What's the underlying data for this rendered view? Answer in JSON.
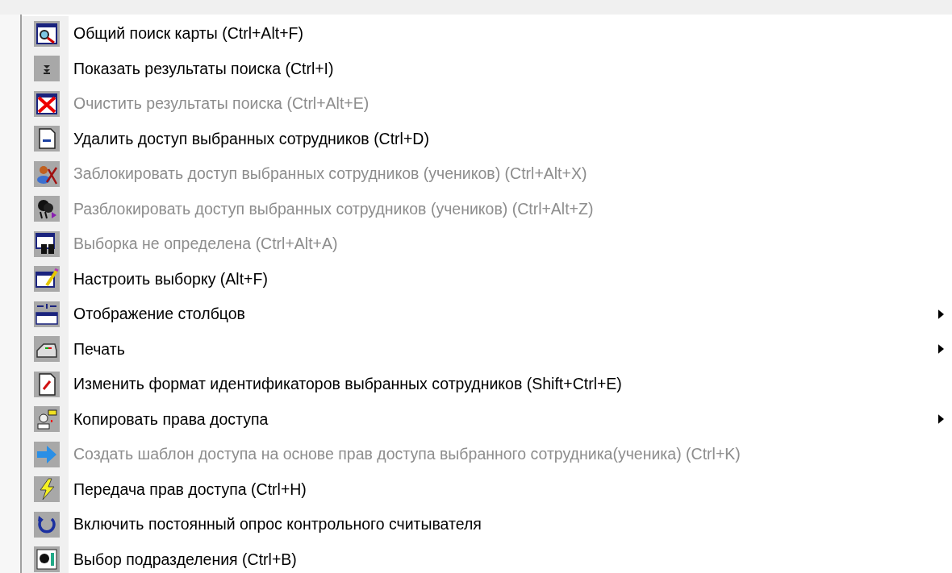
{
  "menu": {
    "items": [
      {
        "label": "Общий поиск карты (Ctrl+Alt+F)",
        "disabled": false,
        "has_submenu": false
      },
      {
        "label": "Показать результаты поиска (Ctrl+I)",
        "disabled": false,
        "has_submenu": false
      },
      {
        "label": "Очистить результаты поиска (Ctrl+Alt+E)",
        "disabled": true,
        "has_submenu": false
      },
      {
        "label": "Удалить доступ выбранных сотрудников (Ctrl+D)",
        "disabled": false,
        "has_submenu": false
      },
      {
        "label": "Заблокировать доступ выбранных сотрудников (учеников) (Ctrl+Alt+X)",
        "disabled": true,
        "has_submenu": false
      },
      {
        "label": "Разблокировать доступ выбранных сотрудников (учеников) (Ctrl+Alt+Z)",
        "disabled": true,
        "has_submenu": false
      },
      {
        "label": "Выборка не определена (Ctrl+Alt+A)",
        "disabled": true,
        "has_submenu": false
      },
      {
        "label": "Настроить выборку (Alt+F)",
        "disabled": false,
        "has_submenu": false
      },
      {
        "label": "Отображение столбцов",
        "disabled": false,
        "has_submenu": true
      },
      {
        "label": "Печать",
        "disabled": false,
        "has_submenu": true
      },
      {
        "label": "Изменить формат идентификаторов выбранных сотрудников (Shift+Ctrl+E)",
        "disabled": false,
        "has_submenu": false
      },
      {
        "label": "Копировать права доступа",
        "disabled": false,
        "has_submenu": true
      },
      {
        "label": "Создать шаблон доступа на основе прав доступа выбранного сотрудника(ученика) (Ctrl+K)",
        "disabled": true,
        "has_submenu": false
      },
      {
        "label": "Передача прав доступа (Ctrl+H)",
        "disabled": false,
        "has_submenu": false
      },
      {
        "label": "Включить постоянный опрос контрольного считывателя",
        "disabled": false,
        "has_submenu": false
      },
      {
        "label": "Выбор подразделения (Ctrl+B)",
        "disabled": false,
        "has_submenu": false
      }
    ]
  }
}
